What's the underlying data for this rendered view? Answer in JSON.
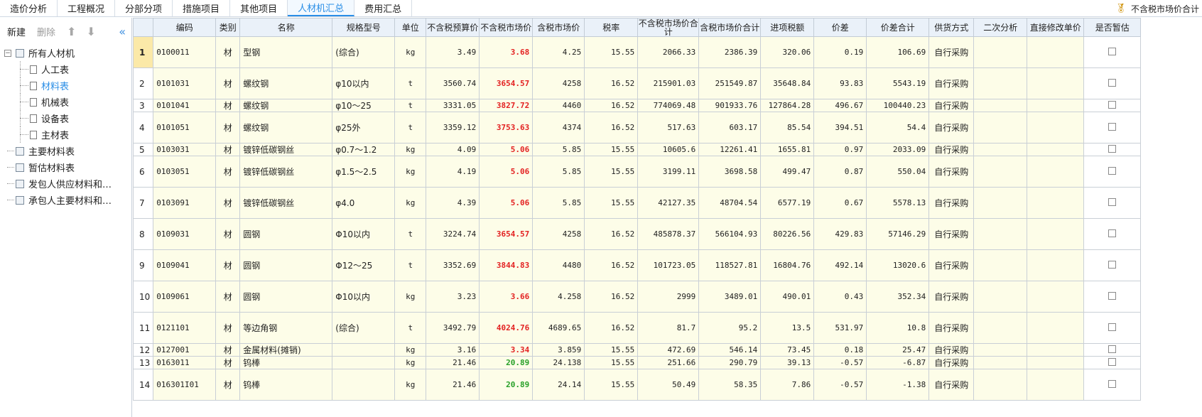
{
  "tabs": [
    "造价分析",
    "工程概况",
    "分部分项",
    "措施项目",
    "其他项目",
    "人材机汇总",
    "费用汇总"
  ],
  "active_tab_index": 5,
  "topright": {
    "label": "不含税市场价合计",
    "icon": "medal-icon"
  },
  "left_toolbar": {
    "new": "新建",
    "delete": "删除",
    "up_icon": "arrow-up-icon",
    "down_icon": "arrow-down-icon",
    "collapse_icon": "double-chevron-left-icon"
  },
  "tree": {
    "root": "所有人材机",
    "children": [
      "人工表",
      "材料表",
      "机械表",
      "设备表",
      "主材表"
    ],
    "selected_child": "材料表",
    "others": [
      "主要材料表",
      "暂估材料表",
      "发包人供应材料和…",
      "承包人主要材料和…"
    ]
  },
  "columns": [
    "编码",
    "类别",
    "名称",
    "规格型号",
    "单位",
    "不含税预算价",
    "不含税市场价",
    "含税市场价",
    "税率",
    "不含税市场价合计",
    "含税市场价合计",
    "进项税额",
    "价差",
    "价差合计",
    "供货方式",
    "二次分析",
    "直接修改单价",
    "是否暂估"
  ],
  "rows": [
    {
      "no": "1",
      "code": "0100011",
      "cat": "材",
      "name": "型钢",
      "spec": "(综合)",
      "unit": "kg",
      "budget": "3.49",
      "market": "3.68",
      "mcolor": "red",
      "tax_market": "4.25",
      "rate": "15.55",
      "sum_notax": "2066.33",
      "sum_tax": "2386.39",
      "input_tax": "320.06",
      "diff": "0.19",
      "diff_sum": "106.69",
      "supply": "自行采购"
    },
    {
      "no": "2",
      "code": "0101031",
      "cat": "材",
      "name": "螺纹钢",
      "spec": "φ10以内",
      "unit": "t",
      "budget": "3560.74",
      "market": "3654.57",
      "mcolor": "red",
      "tax_market": "4258",
      "rate": "16.52",
      "sum_notax": "215901.03",
      "sum_tax": "251549.87",
      "input_tax": "35648.84",
      "diff": "93.83",
      "diff_sum": "5543.19",
      "supply": "自行采购"
    },
    {
      "no": "3",
      "code": "0101041",
      "cat": "材",
      "name": "螺纹钢",
      "spec": "φ10～25",
      "unit": "t",
      "budget": "3331.05",
      "market": "3827.72",
      "mcolor": "red",
      "tax_market": "4460",
      "rate": "16.52",
      "sum_notax": "774069.48",
      "sum_tax": "901933.76",
      "input_tax": "127864.28",
      "diff": "496.67",
      "diff_sum": "100440.23",
      "supply": "自行采购"
    },
    {
      "no": "4",
      "code": "0101051",
      "cat": "材",
      "name": "螺纹钢",
      "spec": "φ25外",
      "unit": "t",
      "budget": "3359.12",
      "market": "3753.63",
      "mcolor": "red",
      "tax_market": "4374",
      "rate": "16.52",
      "sum_notax": "517.63",
      "sum_tax": "603.17",
      "input_tax": "85.54",
      "diff": "394.51",
      "diff_sum": "54.4",
      "supply": "自行采购"
    },
    {
      "no": "5",
      "code": "0103031",
      "cat": "材",
      "name": "镀锌低碳钢丝",
      "spec": "φ0.7～1.2",
      "unit": "kg",
      "budget": "4.09",
      "market": "5.06",
      "mcolor": "red",
      "tax_market": "5.85",
      "rate": "15.55",
      "sum_notax": "10605.6",
      "sum_tax": "12261.41",
      "input_tax": "1655.81",
      "diff": "0.97",
      "diff_sum": "2033.09",
      "supply": "自行采购"
    },
    {
      "no": "6",
      "code": "0103051",
      "cat": "材",
      "name": "镀锌低碳钢丝",
      "spec": "φ1.5～2.5",
      "unit": "kg",
      "budget": "4.19",
      "market": "5.06",
      "mcolor": "red",
      "tax_market": "5.85",
      "rate": "15.55",
      "sum_notax": "3199.11",
      "sum_tax": "3698.58",
      "input_tax": "499.47",
      "diff": "0.87",
      "diff_sum": "550.04",
      "supply": "自行采购"
    },
    {
      "no": "7",
      "code": "0103091",
      "cat": "材",
      "name": "镀锌低碳钢丝",
      "spec": "φ4.0",
      "unit": "kg",
      "budget": "4.39",
      "market": "5.06",
      "mcolor": "red",
      "tax_market": "5.85",
      "rate": "15.55",
      "sum_notax": "42127.35",
      "sum_tax": "48704.54",
      "input_tax": "6577.19",
      "diff": "0.67",
      "diff_sum": "5578.13",
      "supply": "自行采购"
    },
    {
      "no": "8",
      "code": "0109031",
      "cat": "材",
      "name": "圆钢",
      "spec": "Φ10以内",
      "unit": "t",
      "budget": "3224.74",
      "market": "3654.57",
      "mcolor": "red",
      "tax_market": "4258",
      "rate": "16.52",
      "sum_notax": "485878.37",
      "sum_tax": "566104.93",
      "input_tax": "80226.56",
      "diff": "429.83",
      "diff_sum": "57146.29",
      "supply": "自行采购"
    },
    {
      "no": "9",
      "code": "0109041",
      "cat": "材",
      "name": "圆钢",
      "spec": "Φ12～25",
      "unit": "t",
      "budget": "3352.69",
      "market": "3844.83",
      "mcolor": "red",
      "tax_market": "4480",
      "rate": "16.52",
      "sum_notax": "101723.05",
      "sum_tax": "118527.81",
      "input_tax": "16804.76",
      "diff": "492.14",
      "diff_sum": "13020.6",
      "supply": "自行采购"
    },
    {
      "no": "10",
      "code": "0109061",
      "cat": "材",
      "name": "圆钢",
      "spec": "Φ10以内",
      "unit": "kg",
      "budget": "3.23",
      "market": "3.66",
      "mcolor": "red",
      "tax_market": "4.258",
      "rate": "16.52",
      "sum_notax": "2999",
      "sum_tax": "3489.01",
      "input_tax": "490.01",
      "diff": "0.43",
      "diff_sum": "352.34",
      "supply": "自行采购"
    },
    {
      "no": "11",
      "code": "0121101",
      "cat": "材",
      "name": "等边角钢",
      "spec": "(综合)",
      "unit": "t",
      "budget": "3492.79",
      "market": "4024.76",
      "mcolor": "red",
      "tax_market": "4689.65",
      "rate": "16.52",
      "sum_notax": "81.7",
      "sum_tax": "95.2",
      "input_tax": "13.5",
      "diff": "531.97",
      "diff_sum": "10.8",
      "supply": "自行采购"
    },
    {
      "no": "12",
      "code": "0127001",
      "cat": "材",
      "name": "金属材料(摊销)",
      "spec": "",
      "unit": "kg",
      "budget": "3.16",
      "market": "3.34",
      "mcolor": "red",
      "tax_market": "3.859",
      "rate": "15.55",
      "sum_notax": "472.69",
      "sum_tax": "546.14",
      "input_tax": "73.45",
      "diff": "0.18",
      "diff_sum": "25.47",
      "supply": "自行采购"
    },
    {
      "no": "13",
      "code": "0163011",
      "cat": "材",
      "name": "钨棒",
      "spec": "",
      "unit": "kg",
      "budget": "21.46",
      "market": "20.89",
      "mcolor": "green",
      "tax_market": "24.138",
      "rate": "15.55",
      "sum_notax": "251.66",
      "sum_tax": "290.79",
      "input_tax": "39.13",
      "diff": "-0.57",
      "diff_sum": "-6.87",
      "supply": "自行采购"
    },
    {
      "no": "14",
      "code": "016301I01",
      "cat": "材",
      "name": "钨棒",
      "spec": "",
      "unit": "kg",
      "budget": "21.46",
      "market": "20.89",
      "mcolor": "green",
      "tax_market": "24.14",
      "rate": "15.55",
      "sum_notax": "50.49",
      "sum_tax": "58.35",
      "input_tax": "7.86",
      "diff": "-0.57",
      "diff_sum": "-1.38",
      "supply": "自行采购"
    }
  ]
}
